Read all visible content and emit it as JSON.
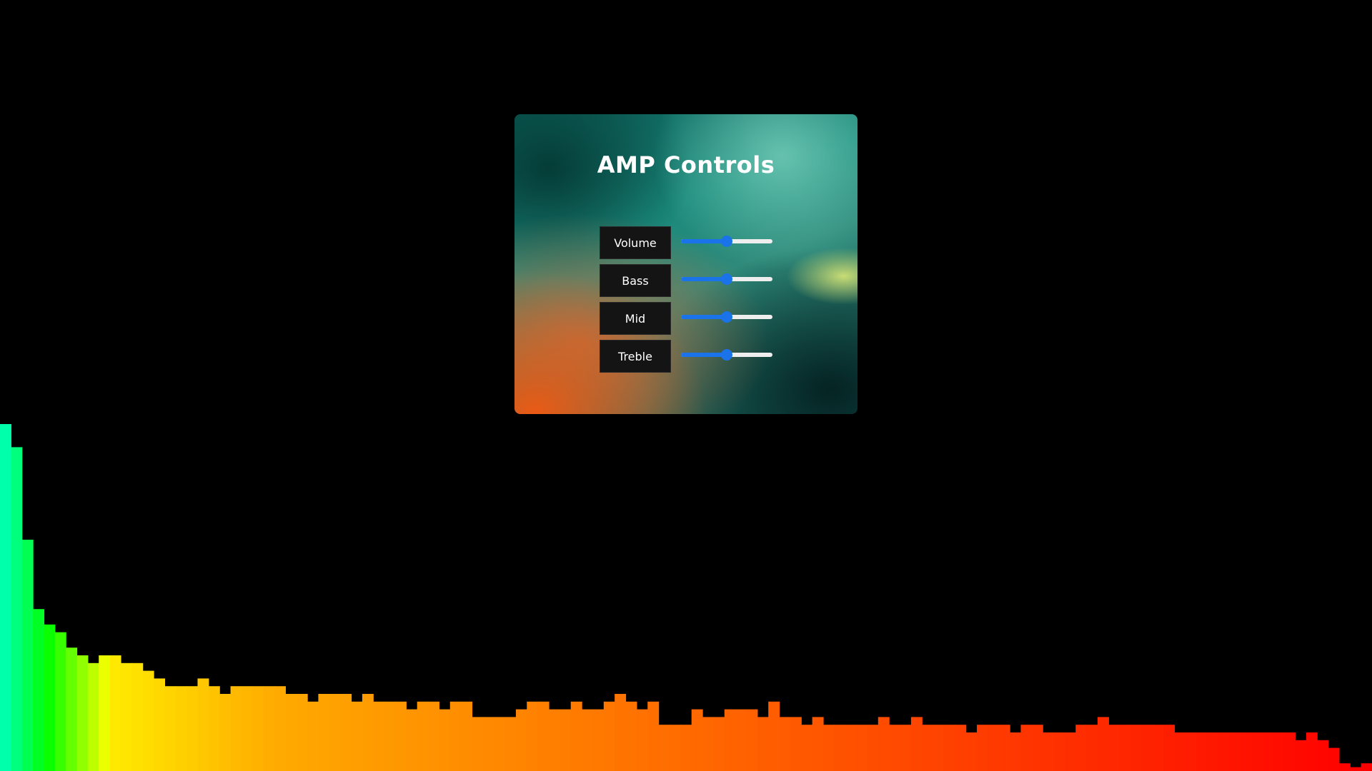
{
  "amp": {
    "title": "AMP Controls",
    "controls": [
      {
        "label": "Volume",
        "value": 0.5
      },
      {
        "label": "Bass",
        "value": 0.5
      },
      {
        "label": "Mid",
        "value": 0.5
      },
      {
        "label": "Treble",
        "value": 0.5
      }
    ]
  },
  "colors": {
    "slider_accent": "#1a73e8",
    "slider_track": "#eeeeee",
    "label_bg": "#141414",
    "background": "#000000"
  },
  "chart_data": {
    "type": "bar",
    "ylim": [
      0,
      1
    ],
    "values": [
      0.45,
      0.42,
      0.3,
      0.21,
      0.19,
      0.18,
      0.16,
      0.15,
      0.14,
      0.15,
      0.15,
      0.14,
      0.14,
      0.13,
      0.12,
      0.11,
      0.11,
      0.11,
      0.12,
      0.11,
      0.1,
      0.11,
      0.11,
      0.11,
      0.11,
      0.11,
      0.1,
      0.1,
      0.09,
      0.1,
      0.1,
      0.1,
      0.09,
      0.1,
      0.09,
      0.09,
      0.09,
      0.08,
      0.09,
      0.09,
      0.08,
      0.09,
      0.09,
      0.07,
      0.07,
      0.07,
      0.07,
      0.08,
      0.09,
      0.09,
      0.08,
      0.08,
      0.09,
      0.08,
      0.08,
      0.09,
      0.1,
      0.09,
      0.08,
      0.09,
      0.06,
      0.06,
      0.06,
      0.08,
      0.07,
      0.07,
      0.08,
      0.08,
      0.08,
      0.07,
      0.09,
      0.07,
      0.07,
      0.06,
      0.07,
      0.06,
      0.06,
      0.06,
      0.06,
      0.06,
      0.07,
      0.06,
      0.06,
      0.07,
      0.06,
      0.06,
      0.06,
      0.06,
      0.05,
      0.06,
      0.06,
      0.06,
      0.05,
      0.06,
      0.06,
      0.05,
      0.05,
      0.05,
      0.06,
      0.06,
      0.07,
      0.06,
      0.06,
      0.06,
      0.06,
      0.06,
      0.06,
      0.05,
      0.05,
      0.05,
      0.05,
      0.05,
      0.05,
      0.05,
      0.05,
      0.05,
      0.05,
      0.05,
      0.04,
      0.05,
      0.04,
      0.03,
      0.01,
      0.005,
      0.01
    ]
  }
}
